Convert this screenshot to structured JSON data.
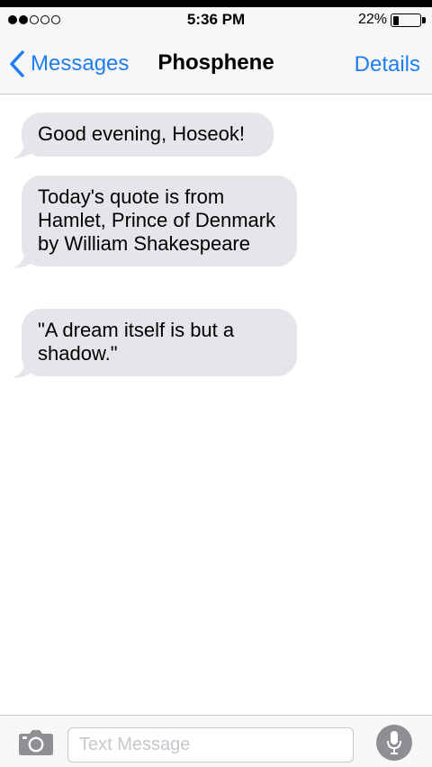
{
  "status_bar": {
    "time": "5:36 PM",
    "battery_percent": "22%",
    "battery_level": 0.22,
    "signal_bars_filled": 2,
    "signal_bars_total": 5
  },
  "nav": {
    "back_label": "Messages",
    "title": "Phosphene",
    "details_label": "Details"
  },
  "messages": [
    {
      "text": "Good evening, Hoseok!"
    },
    {
      "text": "Today's quote is from Hamlet, Prince of Denmark by William Shakespeare"
    },
    {
      "text": "\"A dream itself is but a shadow.\""
    }
  ],
  "input": {
    "placeholder": "Text Message",
    "value": ""
  },
  "colors": {
    "accent": "#1f7df2",
    "bubble_received": "#e5e5ea",
    "bar_background": "#f7f7f7"
  },
  "icons": {
    "back": "chevron-left-icon",
    "camera": "camera-icon",
    "mic": "microphone-icon"
  }
}
